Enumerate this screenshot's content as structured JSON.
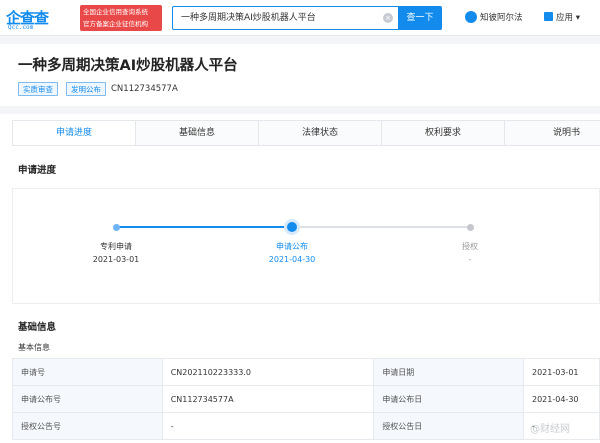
{
  "brand": {
    "logo_text": "企查查",
    "logo_domain": "Qcc.com",
    "badge_line1": "全国企业信用查询系统",
    "badge_line2": "官方备案企业征信机构",
    "accent": "#128bed",
    "badge_color": "#e94848"
  },
  "search": {
    "value": "一种多周期决策AI炒股机器人平台",
    "button": "查一下",
    "clear_icon": "×"
  },
  "nav": {
    "user": "知彼阿尔法",
    "apps": "应用",
    "apps_caret": "▾"
  },
  "header": {
    "title": "一种多周期决策AI炒股机器人平台",
    "tags": [
      "实质审查",
      "发明公布"
    ],
    "pub_number": "CN112734577A"
  },
  "tabs": [
    "申请进度",
    "基础信息",
    "法律状态",
    "权利要求",
    "说明书"
  ],
  "active_tab": 0,
  "progress": {
    "title": "申请进度",
    "steps": [
      {
        "label": "专利申请",
        "date": "2021-03-01",
        "state": "done"
      },
      {
        "label": "申请公布",
        "date": "2021-04-30",
        "state": "current"
      },
      {
        "label": "授权",
        "date": "-",
        "state": "pending"
      }
    ]
  },
  "basic": {
    "title": "基础信息",
    "subtitle": "基本信息",
    "rows": [
      {
        "k1": "申请号",
        "v1": "CN202110223333.0",
        "k2": "申请日期",
        "v2": "2021-03-01"
      },
      {
        "k1": "申请公布号",
        "v1": "CN112734577A",
        "k2": "申请公布日",
        "v2": "2021-04-30"
      },
      {
        "k1": "授权公告号",
        "v1": "-",
        "k2": "授权公告日",
        "v2": "-"
      }
    ]
  },
  "watermark": "@财经网"
}
